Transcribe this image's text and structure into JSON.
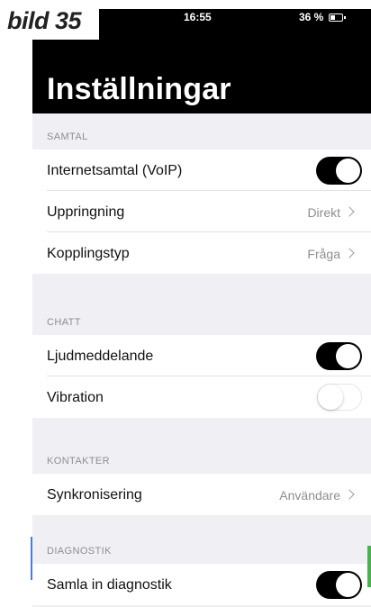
{
  "caption": "bild 35",
  "status_bar": {
    "time": "16:55",
    "battery": "36 %",
    "battery_icon": "battery-icon"
  },
  "title": "Inställningar",
  "sections": {
    "samtal": {
      "header": "SAMTAL",
      "voip": {
        "label": "Internetsamtal (VoIP)",
        "toggle": "on"
      },
      "uppringning": {
        "label": "Uppringning",
        "value": "Direkt"
      },
      "kopplingstyp": {
        "label": "Kopplingstyp",
        "value": "Fråga"
      }
    },
    "chatt": {
      "header": "CHATT",
      "ljud": {
        "label": "Ljudmeddelande",
        "toggle": "on"
      },
      "vibration": {
        "label": "Vibration",
        "toggle": "off"
      }
    },
    "kontakter": {
      "header": "KONTAKTER",
      "synk": {
        "label": "Synkronisering",
        "value": "Användare"
      }
    },
    "diagnostik": {
      "header": "DIAGNOSTIK",
      "samla": {
        "label": "Samla in diagnostik",
        "toggle": "on"
      }
    }
  },
  "colors": {
    "header_bg": "#000000",
    "list_bg": "#efeff4",
    "toggle_on": "#000000",
    "left_edge_mark": "#4b7bd9",
    "right_edge_mark": "#4caf50"
  }
}
